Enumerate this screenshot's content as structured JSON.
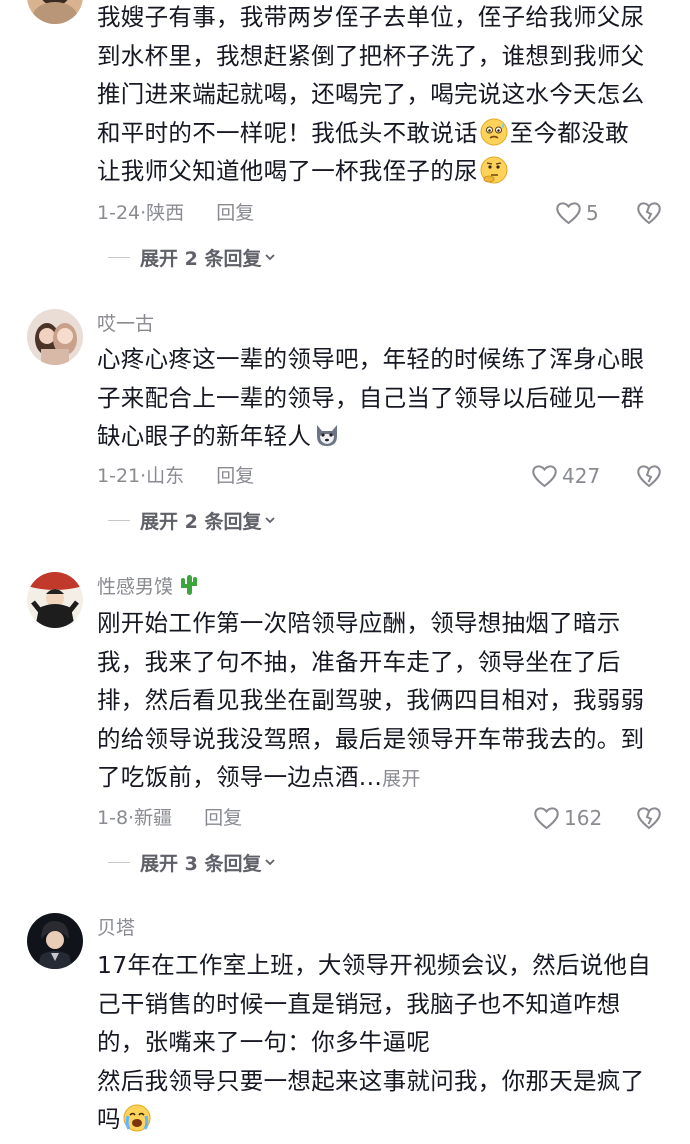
{
  "comments": [
    {
      "username": "",
      "lines": [
        "我嫂子有事，我带两岁侄子去单位，侄子给我师父尿",
        "到水杯里，我想赶紧倒了把杯子洗了，谁想到我师父",
        "推门进来端起就喝，还喝完了，喝完说这水今天怎么",
        "和平时的不一样呢！我低头不敢说话",
        "至今都没敢",
        "让我师父知道他喝了一杯我侄子的尿"
      ],
      "emojis": [
        "sweat-smile-emoji",
        "thinking-emoji"
      ],
      "date": "1-24",
      "location": "陕西",
      "reply_label": "回复",
      "likes": "5",
      "expand_label": "展开 2 条回复"
    },
    {
      "username": "哎一古",
      "lines": [
        "心疼心疼这一辈的领导吧，年轻的时候练了浑身心眼",
        "子来配合上一辈的领导，自己当了领导以后碰见一群",
        "缺心眼子的新年轻人"
      ],
      "emojis": [
        "wolf-emoji"
      ],
      "date": "1-21",
      "location": "山东",
      "reply_label": "回复",
      "likes": "427",
      "expand_label": "展开 2 条回复"
    },
    {
      "username": "性感男馍",
      "username_emoji": "cactus-emoji",
      "lines": [
        "刚开始工作第一次陪领导应酬，领导想抽烟了暗示",
        "我，我来了句不抽，准备开车走了，领导坐在了后",
        "排，然后看见我坐在副驾驶，我俩四目相对，我弱弱",
        "的给领导说我没驾照，最后是领导开车带我去的。到",
        "了吃饭前，领导一边点酒..."
      ],
      "inline_expand": "展开",
      "date": "1-8",
      "location": "新疆",
      "reply_label": "回复",
      "likes": "162",
      "expand_label": "展开 3 条回复"
    },
    {
      "username": "贝塔",
      "lines": [
        "17年在工作室上班，大领导开视频会议，然后说他自",
        "己干销售的时候一直是销冠，我脑子也不知道咋想",
        "的，张嘴来了一句：你多牛逼呢",
        "然后我领导只要一想起来这事就问我，你那天是疯了",
        "吗"
      ],
      "emojis": [
        "crying-emoji"
      ]
    }
  ],
  "icons": {
    "like": "heart-outline-icon",
    "dislike": "broken-heart-icon",
    "chevron": "chevron-down-icon"
  },
  "colors": {
    "text": "#161823",
    "secondary": "#8a8b91",
    "expand": "#5f6068"
  }
}
